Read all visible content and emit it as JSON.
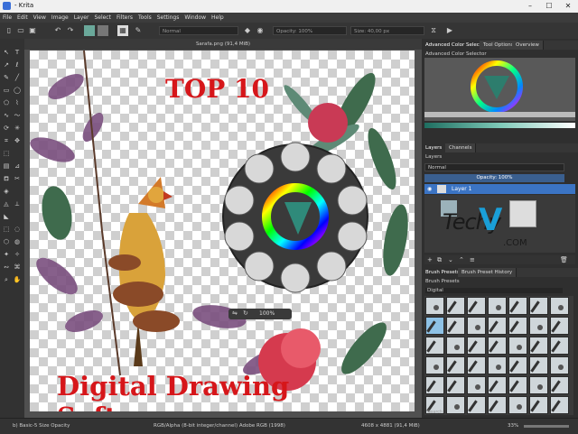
{
  "window": {
    "title": "- Krita"
  },
  "menu": [
    "File",
    "Edit",
    "View",
    "Image",
    "Layer",
    "Select",
    "Filters",
    "Tools",
    "Settings",
    "Window",
    "Help"
  ],
  "toolbar": {
    "blend_mode": "Normal",
    "opacity": "Opacity: 100%",
    "size": "Size: 40,00 px"
  },
  "document": {
    "tab_title": "Sarafa.png (91,4 MiB)"
  },
  "overlay": {
    "headline": "TOP 10",
    "subtitle": "Digital Drawing Software"
  },
  "docker": {
    "tabs": [
      "Advanced Color Selector",
      "Tool Options",
      "Overview"
    ],
    "color_selector_title": "Advanced Color Selector",
    "layer_tabs": [
      "Layers",
      "Channels"
    ],
    "layers_title": "Layers",
    "blend_mode": "Normal",
    "opacity": "Opacity: 100%",
    "layer_name": "Layer 1",
    "brush_tabs": [
      "Brush Presets",
      "Brush Preset History"
    ],
    "brush_presets_title": "Brush Presets",
    "brush_filter": "Digital",
    "search_placeholder": "Search"
  },
  "popup": {
    "zoom": "100%"
  },
  "watermark": {
    "brand": "Techy",
    "v": "V",
    "domain": ".COM"
  },
  "status": {
    "brush": "b) Basic-5 Size Opacity",
    "color": "RGB/Alpha (8-bit integer/channel)  Adobe RGB (1998)",
    "size": "4608 x 4881 (91,4 MiB)",
    "zoom": "33%"
  },
  "colors": {
    "accent": "#3b74c4",
    "headline": "#d6161a",
    "watermark_v": "#1a9fd8"
  }
}
